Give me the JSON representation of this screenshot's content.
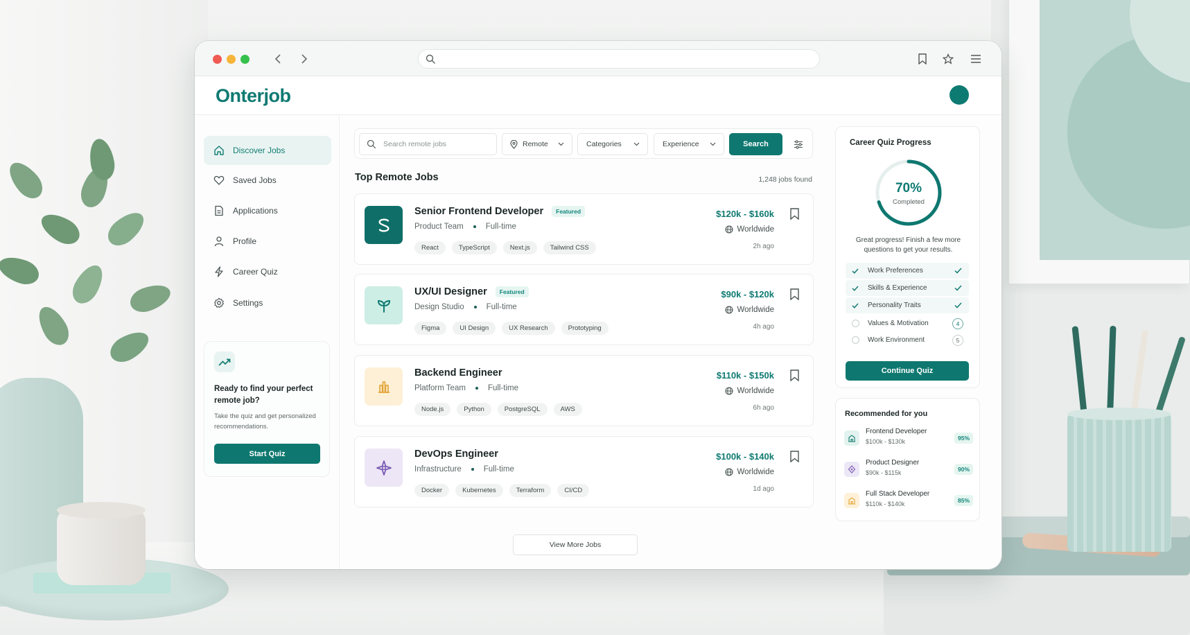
{
  "app": {
    "logo": "Onterjob"
  },
  "colors": {
    "accent": "#0e7870",
    "accent_light": "#e9f4f2"
  },
  "sidebar": {
    "items": [
      {
        "label": "Discover Jobs",
        "icon": "home-icon",
        "active": true
      },
      {
        "label": "Saved Jobs",
        "icon": "heart-icon"
      },
      {
        "label": "Applications",
        "icon": "document-icon"
      },
      {
        "label": "Profile",
        "icon": "user-icon"
      },
      {
        "label": "Career Quiz",
        "icon": "lightning-icon"
      },
      {
        "label": "Settings",
        "icon": "gear-icon"
      }
    ],
    "promo": {
      "title": "Ready to find your perfect remote job?",
      "text": "Take the quiz and get personalized recommendations.",
      "button": "Start Quiz"
    }
  },
  "search": {
    "placeholder": "Search remote jobs",
    "location": "Remote",
    "categories": "Categories",
    "experience": "Experience",
    "button": "Search"
  },
  "listing": {
    "title": "Top Remote Jobs",
    "count": "1,248 jobs found",
    "view_more": "View More Jobs"
  },
  "jobs": [
    {
      "title": "Senior Frontend Developer",
      "featured": "Featured",
      "company": "Product Team",
      "type": "Full-time",
      "tags": [
        "React",
        "TypeScript",
        "Next.js",
        "Tailwind CSS"
      ],
      "salary": "$120k - $160k",
      "location": "Worldwide",
      "posted": "2h ago"
    },
    {
      "title": "UX/UI Designer",
      "featured": "Featured",
      "company": "Design Studio",
      "type": "Full-time",
      "tags": [
        "Figma",
        "UI Design",
        "UX Research",
        "Prototyping"
      ],
      "salary": "$90k - $120k",
      "location": "Worldwide",
      "posted": "4h ago"
    },
    {
      "title": "Backend Engineer",
      "featured": "",
      "company": "Platform Team",
      "type": "Full-time",
      "tags": [
        "Node.js",
        "Python",
        "PostgreSQL",
        "AWS"
      ],
      "salary": "$110k - $150k",
      "location": "Worldwide",
      "posted": "6h ago"
    },
    {
      "title": "DevOps Engineer",
      "featured": "",
      "company": "Infrastructure",
      "type": "Full-time",
      "tags": [
        "Docker",
        "Kubernetes",
        "Terraform",
        "CI/CD"
      ],
      "salary": "$100k - $140k",
      "location": "Worldwide",
      "posted": "1d ago"
    }
  ],
  "quiz": {
    "title": "Career Quiz Progress",
    "progress": 0.7,
    "percent_label": "70%",
    "completed_label": "Completed",
    "message": "Great progress! Finish a few more questions to get your results.",
    "steps": [
      {
        "label": "Work Preferences",
        "done": true
      },
      {
        "label": "Skills & Experience",
        "done": true
      },
      {
        "label": "Personality Traits",
        "done": true
      },
      {
        "label": "Values & Motivation",
        "done": false,
        "number": "4"
      },
      {
        "label": "Work Environment",
        "done": false,
        "number": "5"
      }
    ],
    "button": "Continue Quiz"
  },
  "recommended": {
    "title": "Recommended for you",
    "items": [
      {
        "name": "Frontend Developer",
        "salary": "$100k - $130k",
        "match": "95%"
      },
      {
        "name": "Product Designer",
        "salary": "$90k - $115k",
        "match": "90%"
      },
      {
        "name": "Full Stack Developer",
        "salary": "$110k - $140k",
        "match": "85%"
      }
    ]
  }
}
